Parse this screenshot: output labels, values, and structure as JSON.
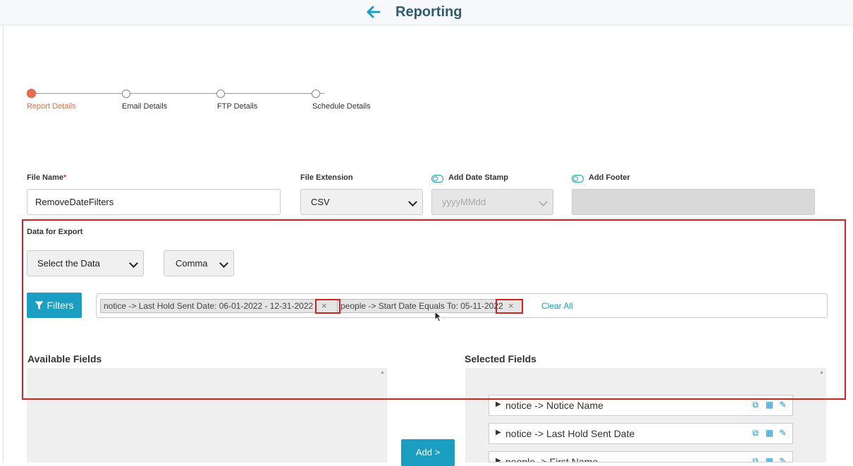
{
  "header": {
    "title": "Reporting"
  },
  "stepper": {
    "steps": [
      {
        "label": "Report Details"
      },
      {
        "label": "Email Details"
      },
      {
        "label": "FTP Details"
      },
      {
        "label": "Schedule Details"
      }
    ],
    "active_step": 1
  },
  "form": {
    "file_name": {
      "label": "File Name",
      "required_mark": "*",
      "value": "RemoveDateFilters"
    },
    "file_extension": {
      "label": "File Extension",
      "value": "CSV"
    },
    "date_stamp": {
      "label": "Add Date Stamp",
      "value": "yyyyMMdd"
    },
    "footer": {
      "label": "Add Footer"
    }
  },
  "export": {
    "title": "Data for Export",
    "data_select": "Select the Data",
    "delimiter_select": "Comma",
    "filters_label": "Filters",
    "chips": [
      {
        "text": "notice -> Last Hold Sent Date: 06-01-2022 - 12-31-2022",
        "remove": "×"
      },
      {
        "text": "people -> Start Date Equals To: 05-11-2022",
        "remove": "×"
      }
    ],
    "clear_all": "Clear All"
  },
  "fields": {
    "available_title": "Available Fields",
    "selected_title": "Selected Fields",
    "add_button": "Add >",
    "selected": [
      {
        "label": "notice -> Notice Name"
      },
      {
        "label": "notice -> Last Hold Sent Date"
      },
      {
        "label": "people -> First Name"
      }
    ]
  },
  "colors": {
    "accent": "#1a9fc2",
    "step_active": "#f26b50",
    "annotation": "#d92020",
    "title": "#2f5d73"
  },
  "icons": [
    "back-arrow-icon",
    "filter-icon",
    "copy-icon",
    "trash-icon",
    "pencil-icon",
    "toggle-icon",
    "chevron-down-icon",
    "caret-right-icon",
    "mouse-cursor-icon"
  ]
}
